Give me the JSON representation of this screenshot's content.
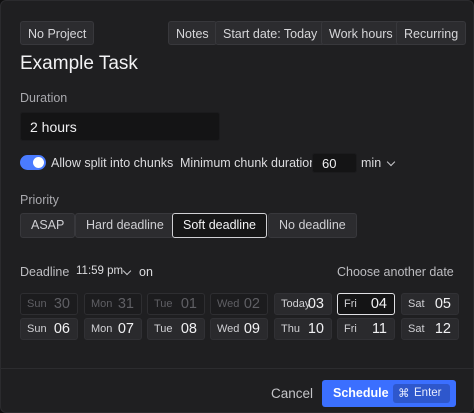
{
  "chips": {
    "project": "No Project",
    "notes": "Notes",
    "start_date": "Start date: Today",
    "work_hours": "Work hours",
    "recurring": "Recurring"
  },
  "task": {
    "title": "Example Task"
  },
  "duration": {
    "label": "Duration",
    "value": "2 hours"
  },
  "split": {
    "enabled": true,
    "label": "Allow split into chunks",
    "min_chunk_label": "Minimum chunk duration",
    "min_chunk_value": "60",
    "unit": "min"
  },
  "priority": {
    "label": "Priority",
    "options": [
      "ASAP",
      "Hard deadline",
      "Soft deadline",
      "No deadline"
    ],
    "selected": "Soft deadline"
  },
  "deadline": {
    "label": "Deadline",
    "time": "11:59 pm",
    "on": "on",
    "choose_another": "Choose another date",
    "days": [
      {
        "name": "Sun",
        "date": "30"
      },
      {
        "name": "Mon",
        "date": "31"
      },
      {
        "name": "Tue",
        "date": "01"
      },
      {
        "name": "Wed",
        "date": "02"
      },
      {
        "name": "Today",
        "date": "03"
      },
      {
        "name": "Fri",
        "date": "04"
      },
      {
        "name": "Sat",
        "date": "05"
      },
      {
        "name": "Sun",
        "date": "06"
      },
      {
        "name": "Mon",
        "date": "07"
      },
      {
        "name": "Tue",
        "date": "08"
      },
      {
        "name": "Wed",
        "date": "09"
      },
      {
        "name": "Thu",
        "date": "10"
      },
      {
        "name": "Fri",
        "date": "11"
      },
      {
        "name": "Sat",
        "date": "12"
      }
    ]
  },
  "footer": {
    "cancel": "Cancel",
    "schedule": "Schedule",
    "shortcut_symbol": "⌘",
    "shortcut_key": "Enter"
  },
  "colors": {
    "accent": "#3b6fff",
    "toggle_on": "#4a7bff",
    "background": "#1f1f21"
  }
}
